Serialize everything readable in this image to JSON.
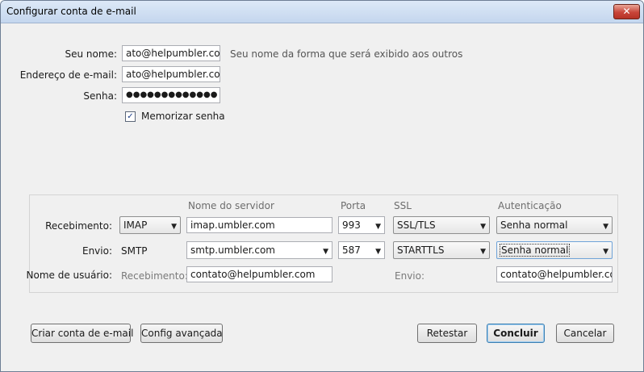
{
  "window": {
    "title": "Configurar conta de e-mail",
    "close_glyph": "✕"
  },
  "identity": {
    "name_label": "Seu nome:",
    "name_value": "ato@helpumbler.com",
    "name_hint": "Seu nome da forma que será exibido aos outros",
    "email_label": "Endereço de e-mail:",
    "email_value": "ato@helpumbler.com",
    "password_label": "Senha:",
    "password_value": "●●●●●●●●●●●●●",
    "remember_label": "Memorizar senha",
    "remember_checked": true
  },
  "server": {
    "headers": {
      "server": "Nome do servidor",
      "port": "Porta",
      "ssl": "SSL",
      "auth": "Autenticação"
    },
    "incoming": {
      "label": "Recebimento:",
      "protocol": "IMAP",
      "host": "imap.umbler.com",
      "port": "993",
      "ssl": "SSL/TLS",
      "auth": "Senha normal"
    },
    "outgoing": {
      "label": "Envio:",
      "protocol": "SMTP",
      "host": "smtp.umbler.com",
      "port": "587",
      "ssl": "STARTTLS",
      "auth": "Senha normal"
    },
    "username": {
      "label": "Nome de usuário:",
      "incoming_label": "Recebimento:",
      "incoming_value": "contato@helpumbler.com",
      "outgoing_label": "Envio:",
      "outgoing_value": "contato@helpumbler.com"
    }
  },
  "buttons": {
    "create_account": "Criar conta de e-mail",
    "advanced_config": "Config avançada",
    "retest": "Retestar",
    "done": "Concluir",
    "cancel": "Cancelar"
  },
  "colors": {
    "title_bar": "#c4d6ee",
    "close_button": "#c8453a",
    "panel_border": "#d4d4d4"
  }
}
